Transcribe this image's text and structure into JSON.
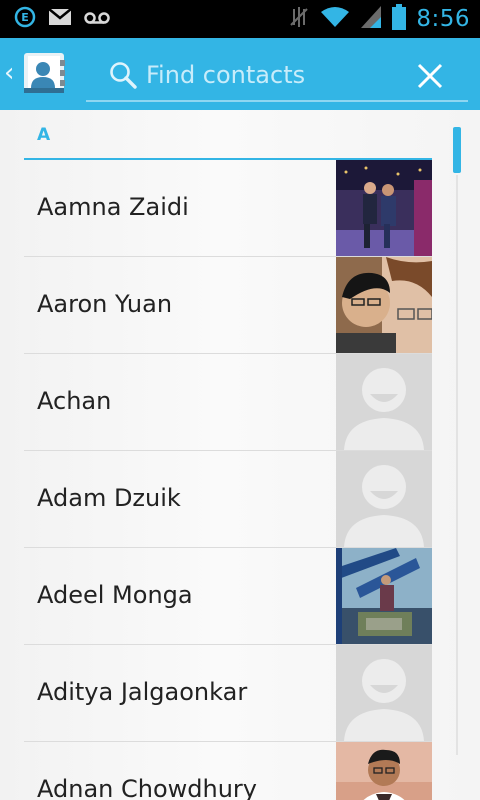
{
  "status_bar": {
    "time": "8:56",
    "left_icons": [
      "evernote-icon",
      "gmail-icon",
      "voicemail-icon"
    ],
    "right_icons": [
      "vibrate-mute-icon",
      "wifi-icon",
      "cell-signal-icon",
      "battery-icon"
    ]
  },
  "action_bar": {
    "search_placeholder": "Find contacts",
    "search_value": "",
    "accent": "#33b5e5"
  },
  "section": {
    "letter": "A"
  },
  "contacts": [
    {
      "name": "Aamna Zaidi",
      "photo": "photo"
    },
    {
      "name": "Aaron Yuan",
      "photo": "photo"
    },
    {
      "name": "Achan",
      "photo": "default-avatar"
    },
    {
      "name": "Adam Dzuik",
      "photo": "default-avatar"
    },
    {
      "name": "Adeel Monga",
      "photo": "photo"
    },
    {
      "name": "Aditya Jalgaonkar",
      "photo": "default-avatar"
    },
    {
      "name": "Adnan Chowdhury",
      "photo": "photo"
    }
  ]
}
